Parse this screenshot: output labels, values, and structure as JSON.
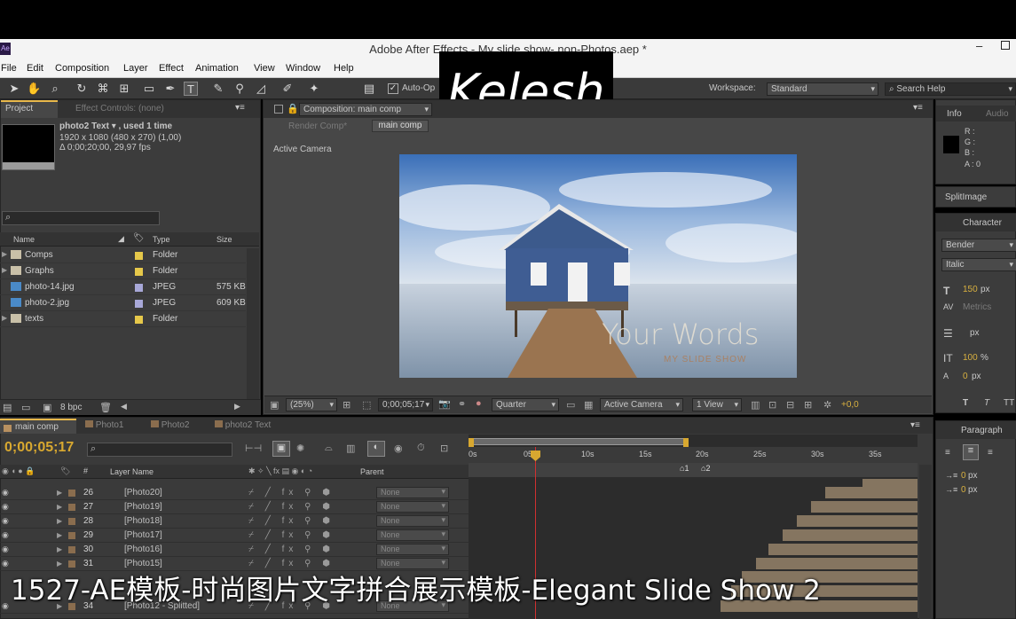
{
  "window": {
    "title": "Adobe After Effects - My slide show- non-Photos.aep *",
    "app_icon": "Ae"
  },
  "menu": [
    "File",
    "Edit",
    "Composition",
    "Layer",
    "Effect",
    "Animation",
    "View",
    "Window",
    "Help"
  ],
  "toolbar": {
    "auto_open": "Auto-Op",
    "workspace_label": "Workspace:",
    "workspace_value": "Standard",
    "search_placeholder": "Search Help"
  },
  "logo": "Kelesh",
  "project": {
    "tab": "Project",
    "effect_tab": "Effect Controls: (none)",
    "item_name": "photo2 Text ▾ , used 1 time",
    "item_dims": "1920 x 1080  (480 x 270) (1,00)",
    "item_dur": "Δ 0;00;20;00, 29,97 fps",
    "headers": {
      "name": "Name",
      "type": "Type",
      "size": "Size"
    },
    "items": [
      {
        "name": "Comps",
        "type": "Folder",
        "size": "",
        "label_color": "#e6c84a"
      },
      {
        "name": "Graphs",
        "type": "Folder",
        "size": "",
        "label_color": "#e6c84a"
      },
      {
        "name": "photo-14.jpg",
        "type": "JPEG",
        "size": "575 KB",
        "label_color": "#a8a8d8"
      },
      {
        "name": "photo-2.jpg",
        "type": "JPEG",
        "size": "609 KB",
        "label_color": "#a8a8d8"
      },
      {
        "name": "texts",
        "type": "Folder",
        "size": "",
        "label_color": "#e6c84a"
      }
    ],
    "bpc": "8 bpc"
  },
  "composition": {
    "tab": "Composition: main comp",
    "render_comp": "Render Comp*",
    "crumb": "main comp",
    "active_camera": "Active Camera",
    "overlay_title": "Your Words",
    "overlay_sub": "MY SLIDE SHOW",
    "zoom": "(25%)",
    "timecode": "0;00;05;17",
    "resolution": "Quarter",
    "camera": "Active Camera",
    "views": "1 View",
    "exposure": "+0,0"
  },
  "info": {
    "tab": "Info",
    "audio_tab": "Audio",
    "r": "R :",
    "g": "G :",
    "b": "B :",
    "a": "A : 0"
  },
  "split_tab": "SplitImage",
  "character": {
    "tab": "Character",
    "font": "Bender",
    "style": "Italic",
    "size": "150",
    "size_unit": "px",
    "kerning": "Metrics",
    "leading_unit": "px",
    "tracking": "100",
    "tracking_unit": "%",
    "baseline": "0",
    "baseline_unit": "px"
  },
  "paragraph": {
    "tab": "Paragraph",
    "indent1": "0",
    "indent2": "0",
    "unit": "px"
  },
  "timeline": {
    "tabs": [
      "main comp",
      "Photo1",
      "Photo2",
      "photo2 Text"
    ],
    "timecode": "0;00;05;17",
    "layer_header": "Layer Name",
    "parent_header": "Parent",
    "hash": "#",
    "ruler": [
      "0s",
      "05s",
      "10s",
      "15s",
      "20s",
      "25s",
      "30s",
      "35s"
    ],
    "markers": [
      "1",
      "2"
    ],
    "layers": [
      {
        "num": "26",
        "name": "[Photo20]",
        "parent": "None"
      },
      {
        "num": "27",
        "name": "[Photo19]",
        "parent": "None"
      },
      {
        "num": "28",
        "name": "[Photo18]",
        "parent": "None"
      },
      {
        "num": "29",
        "name": "[Photo17]",
        "parent": "None"
      },
      {
        "num": "30",
        "name": "[Photo16]",
        "parent": "None"
      },
      {
        "num": "31",
        "name": "[Photo15]",
        "parent": "None"
      },
      {
        "num": "34",
        "name": "[Photo12 - Splitted]",
        "parent": "None"
      }
    ]
  },
  "subtitle": "1527-AE模板-时尚图片文字拼合展示模板-Elegant Slide Show 2"
}
